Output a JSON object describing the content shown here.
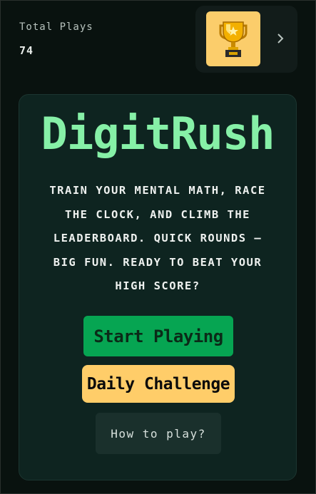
{
  "stats": {
    "label": "Total Plays",
    "value": "74"
  },
  "trophy": {
    "icon": "trophy-icon",
    "tile_color": "#fbcd6b"
  },
  "hero": {
    "title": "DigitRush",
    "description": "Train your mental math, race the clock, and climb the leaderboard. Quick rounds — big fun. Ready to beat your high score?"
  },
  "buttons": {
    "start": "Start Playing",
    "daily": "Daily Challenge",
    "how": "How to play?"
  },
  "colors": {
    "background": "#09120f",
    "card": "#0e2420",
    "accent_title": "#86f0a7",
    "start_green": "#06a552",
    "daily_yellow": "#ffcd69"
  }
}
